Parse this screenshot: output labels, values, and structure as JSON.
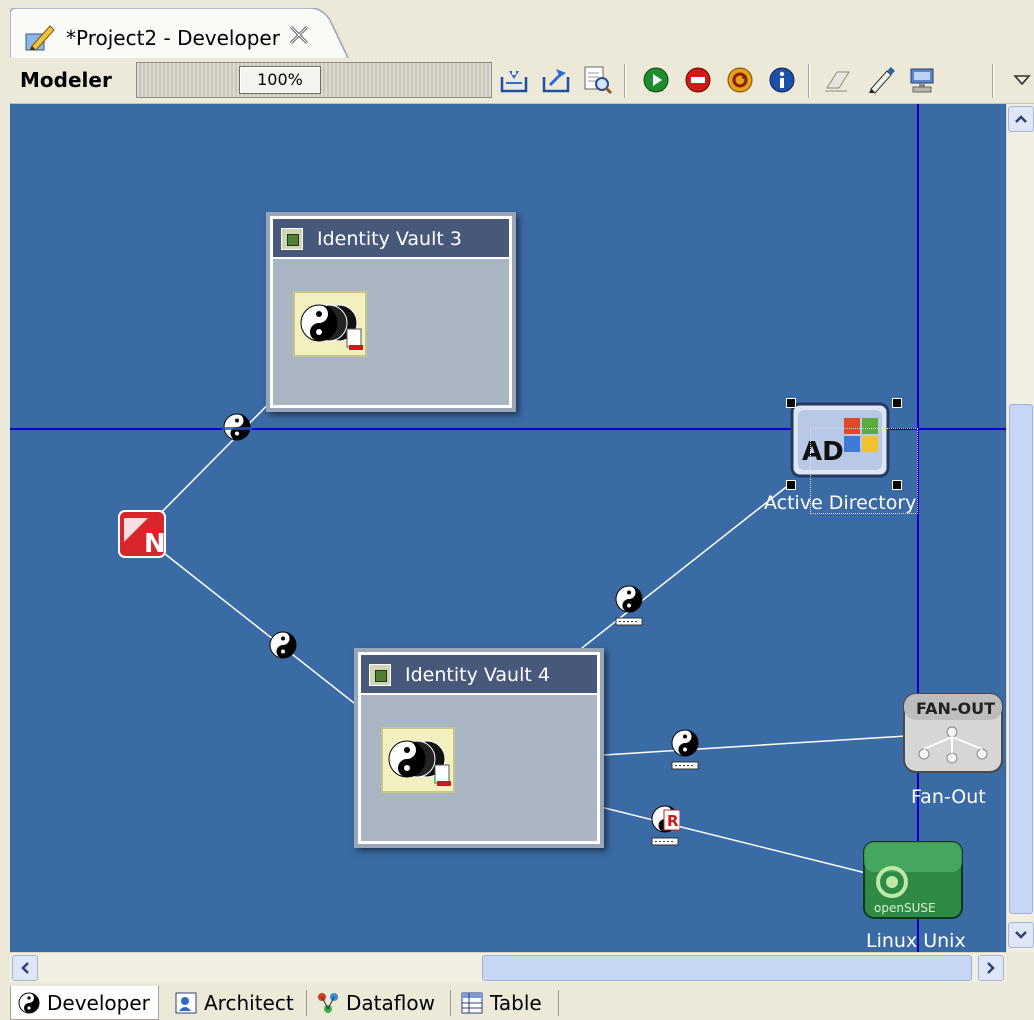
{
  "editor_tab": {
    "title": "*Project2 - Developer",
    "icon": "modeler-pencil-icon",
    "close_icon": "close-icon"
  },
  "toolbar": {
    "label": "Modeler",
    "zoom_value": "100%",
    "buttons": [
      "import-icon",
      "export-icon",
      "inspect-icon",
      "run-icon",
      "stop-icon",
      "refresh-icon",
      "info-icon",
      "eraser-icon",
      "pen-icon",
      "deploy-icon",
      "dropdown-arrow-icon"
    ],
    "colors": {
      "run": "#1e8d2c",
      "stop": "#d01818",
      "refresh": "#e6a315",
      "info": "#1c4fa8"
    }
  },
  "canvas": {
    "background": "#3b6ba5",
    "guide_color": "#0000d0",
    "vaults": [
      {
        "title": "Identity Vault 3"
      },
      {
        "title": "Identity Vault 4"
      }
    ],
    "nodes": [
      {
        "name": "Active Directory",
        "badge": "AD",
        "icon": "active-directory-icon",
        "selected": true
      },
      {
        "name": "Fan-Out",
        "badge": "FAN-OUT",
        "icon": "fan-out-icon"
      },
      {
        "name": "Linux Unix",
        "badge": "openSUSE",
        "icon": "opensuse-icon"
      },
      {
        "name": "",
        "badge": "N",
        "icon": "novell-driver-icon"
      }
    ]
  },
  "scrollbars": {
    "up_icon": "arrow-up-icon",
    "down_icon": "arrow-down-icon",
    "left_icon": "arrow-left-icon",
    "right_icon": "arrow-right-icon"
  },
  "bottom_tabs": [
    {
      "label": "Developer",
      "icon": "developer-yinyang-icon",
      "active": true
    },
    {
      "label": "Architect",
      "icon": "architect-icon",
      "active": false
    },
    {
      "label": "Dataflow",
      "icon": "dataflow-icon",
      "active": false
    },
    {
      "label": "Table",
      "icon": "table-icon",
      "active": false
    }
  ]
}
